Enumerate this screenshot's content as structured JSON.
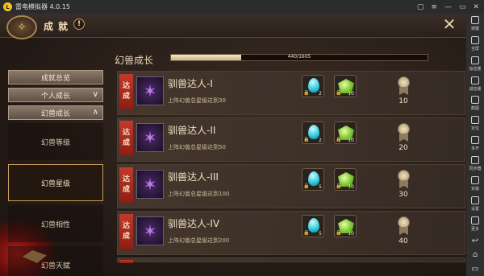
{
  "emulator": {
    "title": "雷电模拟器 4.0.15",
    "logo": "L",
    "controls": [
      "▢",
      "≡",
      "—",
      "▭",
      "✕"
    ],
    "sidebar": [
      {
        "label": "按键",
        "icon": "keyboard-icon"
      },
      {
        "label": "全屏",
        "icon": "fullscreen-icon"
      },
      {
        "label": "加音量",
        "icon": "volume-up-icon"
      },
      {
        "label": "减音量",
        "icon": "volume-down-icon"
      },
      {
        "label": "截图",
        "icon": "screenshot-icon"
      },
      {
        "label": "定位",
        "icon": "location-icon"
      },
      {
        "label": "多开",
        "icon": "multi-instance-icon"
      },
      {
        "label": "同步器",
        "icon": "sync-icon"
      },
      {
        "label": "安装",
        "icon": "install-icon"
      },
      {
        "label": "设置",
        "icon": "settings-icon"
      },
      {
        "label": "更多",
        "icon": "more-icon"
      }
    ],
    "nav": [
      "↩",
      "⌂",
      "▭"
    ]
  },
  "game": {
    "title": "成就",
    "help": "!",
    "close": "✕",
    "emblem": "✧",
    "menu": {
      "overview": "成就总览",
      "personal": "个人成长",
      "beast": "幻兽成长",
      "personal_chevron": "∨",
      "beast_chevron": "∧",
      "subitems": [
        "幻兽等级",
        "幻兽星级",
        "幻兽相性",
        "幻兽天赋"
      ]
    },
    "section_title": "幻兽成长",
    "progress": {
      "current": 440,
      "total": 1605,
      "text": "440/1605"
    },
    "badge_text": [
      "达",
      "成"
    ],
    "item_icon": "✶",
    "rewards": {
      "egg_qty": "2",
      "orb_qty": "10"
    },
    "rows": [
      {
        "title": "驯兽达人-I",
        "desc": "上阵幻兽总星级达到30",
        "egg_qty": "2",
        "orb_qty": "10",
        "points": "10"
      },
      {
        "title": "驯兽达人-II",
        "desc": "上阵幻兽总星级达到50",
        "egg_qty": "2",
        "orb_qty": "10",
        "points": "20"
      },
      {
        "title": "驯兽达人-III",
        "desc": "上阵幻兽总星级达到100",
        "egg_qty": "5",
        "orb_qty": "10",
        "points": "30"
      },
      {
        "title": "驯兽达人-IV",
        "desc": "上阵幻兽总星级达到200",
        "egg_qty": "5",
        "orb_qty": "10",
        "points": "40"
      }
    ],
    "lock_glyph": "🔒"
  }
}
